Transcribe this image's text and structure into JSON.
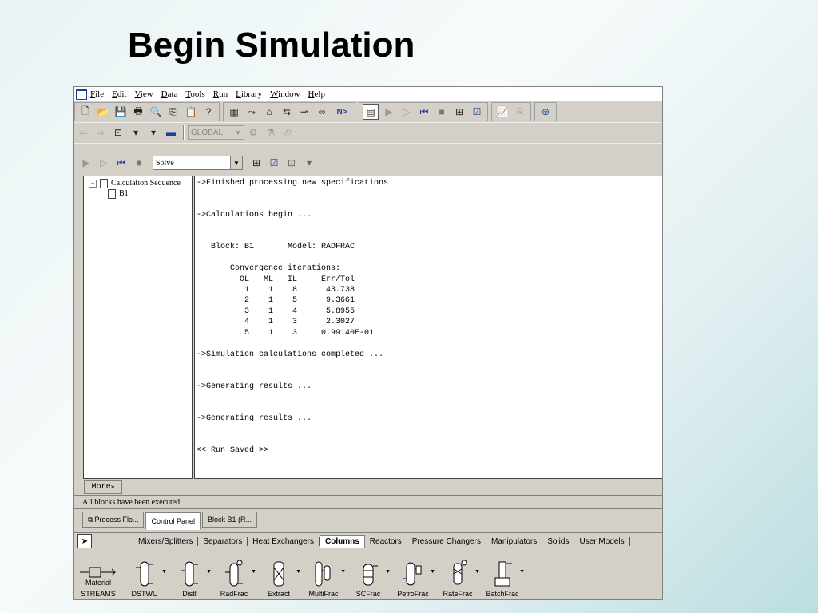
{
  "slide": {
    "title": "Begin Simulation"
  },
  "menu": [
    "File",
    "Edit",
    "View",
    "Data",
    "Tools",
    "Run",
    "Library",
    "Window",
    "Help"
  ],
  "toolbar": {
    "global_combo": "GLOBAL",
    "next_label": "N>"
  },
  "control_panel": {
    "solve_combo": "Solve",
    "tree": {
      "root": "Calculation Sequence",
      "child": "B1"
    },
    "log": [
      "->Finished processing new specifications",
      "",
      "",
      "->Calculations begin ...",
      "",
      "",
      "   Block: B1       Model: RADFRAC",
      "",
      "       Convergence iterations:",
      "         OL   ML   IL     Err/Tol",
      "          1    1    8      43.738",
      "          2    1    5      9.3661",
      "          3    1    4      5.8955",
      "          4    1    3      2.3027",
      "          5    1    3     0.99140E-01",
      "",
      "->Simulation calculations completed ...",
      "",
      "",
      "->Generating results ...",
      "",
      "",
      "->Generating results ...",
      "",
      "",
      "<< Run Saved >>"
    ],
    "more_label": "More"
  },
  "status": "All blocks have been executed",
  "window_tabs": [
    "Process Flo...",
    "Control Panel",
    "Block B1 (R..."
  ],
  "library": {
    "tabs": [
      "Mixers/Splitters",
      "Separators",
      "Heat Exchangers",
      "Columns",
      "Reactors",
      "Pressure Changers",
      "Manipulators",
      "Solids",
      "User Models"
    ],
    "active_tab": "Columns",
    "streams": {
      "top": "Material",
      "bottom": "STREAMS"
    },
    "models": [
      "DSTWU",
      "Distl",
      "RadFrac",
      "Extract",
      "MultiFrac",
      "SCFrac",
      "PetroFrac",
      "RateFrac",
      "BatchFrac"
    ]
  }
}
